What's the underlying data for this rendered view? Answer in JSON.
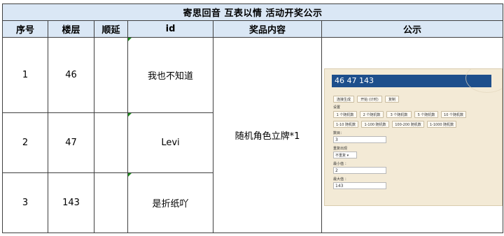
{
  "title": "寄思回音 互表以情  活动开奖公示",
  "headers": [
    "序号",
    "楼层",
    "顺延",
    "id",
    "奖品内容",
    "公示"
  ],
  "rows": [
    {
      "index": "1",
      "floor": "46",
      "defer": "",
      "id": "我也不知道"
    },
    {
      "index": "2",
      "floor": "47",
      "defer": "",
      "id": "Levi"
    },
    {
      "index": "3",
      "floor": "143",
      "defer": "",
      "id": "是折纸吖"
    }
  ],
  "prize": "随机角色立牌*1",
  "screenshot": {
    "result": "46 47 143",
    "buttons": [
      "连接生成",
      "开始 (计时)",
      "复制"
    ],
    "settings_label": "设置",
    "presets_row1": [
      "1 个随机数",
      "2 个随机数",
      "3 个随机数",
      "5 个随机数",
      "10 个随机数"
    ],
    "presets_row2": [
      "1-10 随机数",
      "1-100 随机数",
      "100-200 随机数",
      "1-1000 随机数"
    ],
    "count_label": "数目：",
    "count_value": "3",
    "repeat_label": "重复出现",
    "repeat_value": "不重复",
    "min_label": "最小值  ：",
    "min_value": "2",
    "max_label": "最大值  ：",
    "max_value": "143"
  },
  "colors": {
    "header_bg": "#dae7f5",
    "result_bg": "#1e4f8c",
    "shot_bg": "#f3ead6"
  }
}
